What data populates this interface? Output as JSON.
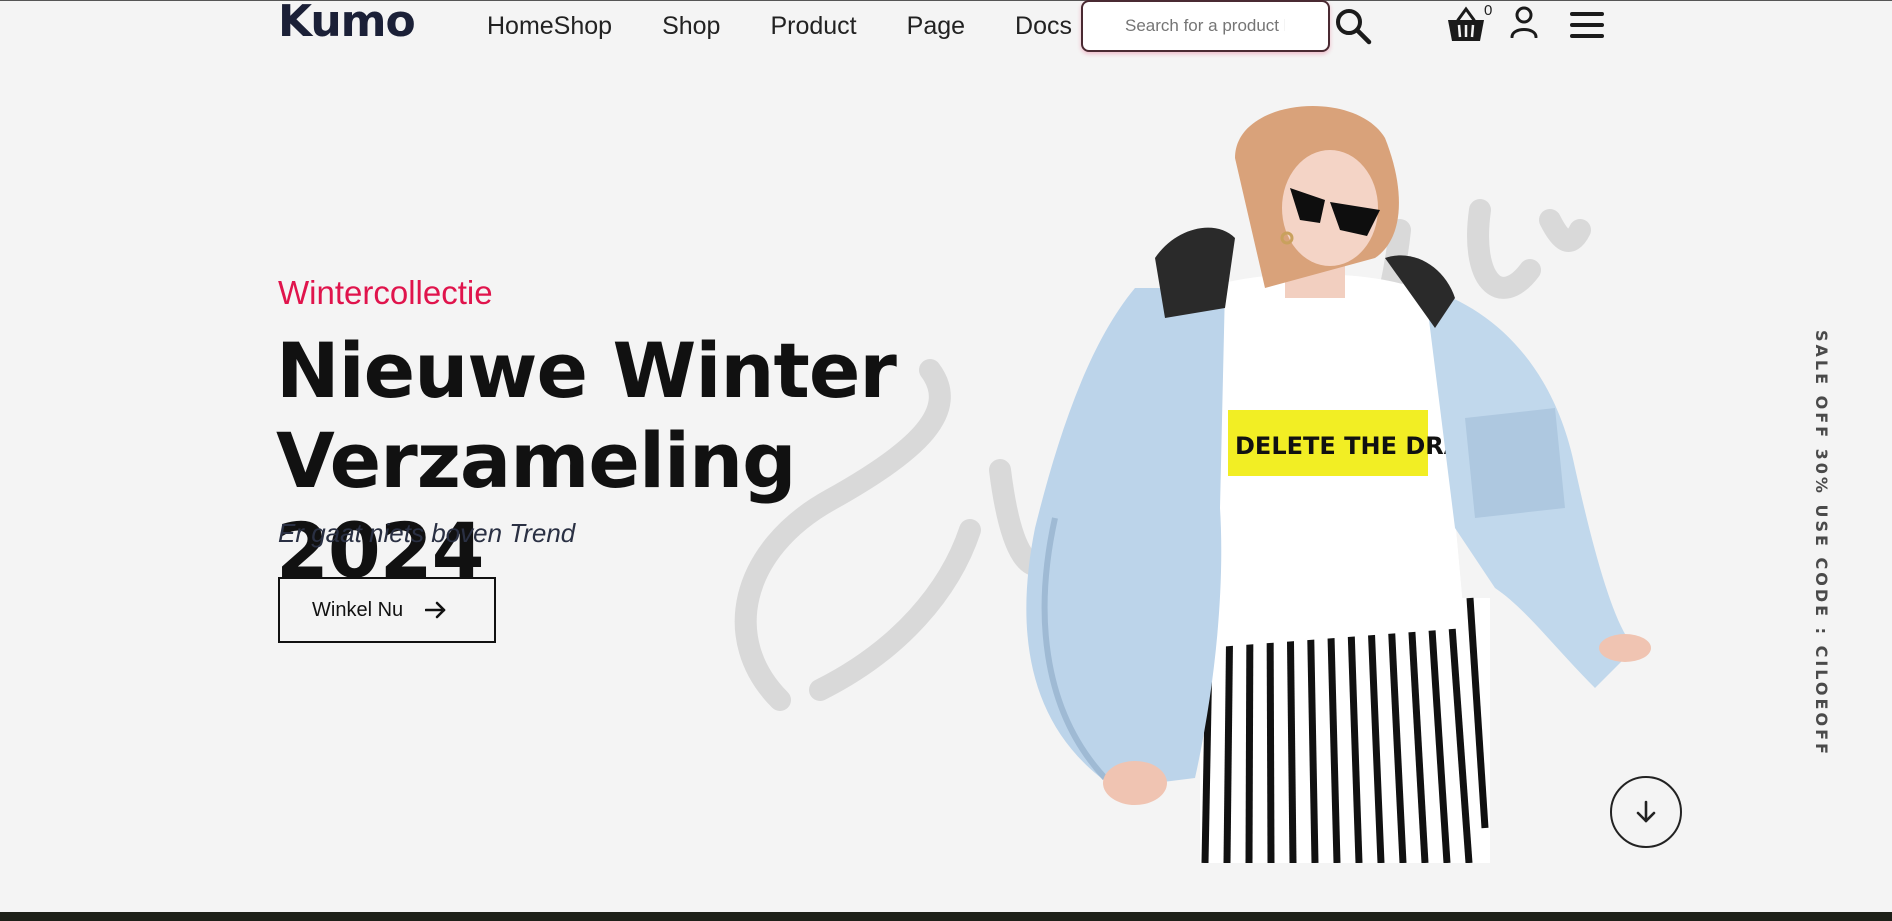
{
  "header": {
    "logo": "Kumo",
    "nav": [
      "HomeShop",
      "Shop",
      "Product",
      "Page",
      "Docs"
    ],
    "search_placeholder": "Search for a product h",
    "cart_count": "0"
  },
  "hero": {
    "subtitle": "Wintercollectie",
    "headline_line1": "Nieuwe Winter",
    "headline_line2": "Verzameling 2024",
    "tagline": "Er gaat niets boven Trend",
    "cta_label": "Winkel Nu",
    "shirt_print": "DELETE THE DRAMA"
  },
  "side_banner": "SALE OFF 30% USE CODE : CILOEOFF",
  "colors": {
    "accent": "#e0144c",
    "navy": "#1b2037",
    "background": "#f4f4f4"
  },
  "icons": [
    "search-icon",
    "basket-icon",
    "user-icon",
    "hamburger-menu-icon",
    "arrow-right-icon",
    "arrow-down-icon"
  ]
}
